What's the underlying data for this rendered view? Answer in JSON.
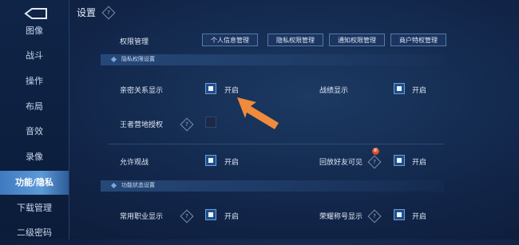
{
  "page": {
    "title": "设置"
  },
  "sidebar": {
    "items": [
      {
        "label": "图像"
      },
      {
        "label": "战斗"
      },
      {
        "label": "操作"
      },
      {
        "label": "布局"
      },
      {
        "label": "音效"
      },
      {
        "label": "录像"
      },
      {
        "label": "功能/隐私",
        "active": true
      },
      {
        "label": "下载管理"
      },
      {
        "label": "二级密码"
      }
    ]
  },
  "permissions": {
    "label": "权限管理",
    "buttons": [
      "个人信息管理",
      "隐私权限管理",
      "通知权限管理",
      "商户特权管理"
    ]
  },
  "privacy_section": {
    "title": "隐私权限设置"
  },
  "settings": {
    "intimacy": {
      "label": "亲密关系显示",
      "state": "开启"
    },
    "battle_record": {
      "label": "战绩显示",
      "state": "开启"
    },
    "camp_auth": {
      "label": "王者营地授权"
    },
    "allow_watch": {
      "label": "允许观战",
      "state": "开启"
    },
    "replay_friends": {
      "label": "回放好友可见",
      "state": "开启",
      "badge": "新"
    },
    "common_job": {
      "label": "常用职业显示",
      "state": "开启"
    },
    "honor_title": {
      "label": "荣耀称号显示",
      "state": "开启"
    }
  },
  "function_section": {
    "title": "功能状态设置"
  },
  "colors": {
    "accent": "#5d9ad8",
    "arrow": "#f08a3c",
    "badge": "#d84a2c"
  }
}
